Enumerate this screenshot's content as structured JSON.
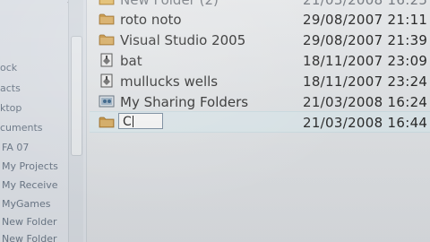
{
  "navigation": {
    "items": [
      "ock",
      "acts",
      "ktop",
      "cuments",
      "FA 07",
      "My Projects",
      "My Receive",
      "MyGames",
      "New Folder",
      "New Folder"
    ]
  },
  "files": {
    "rows": [
      {
        "name": "New Folder (2)",
        "date": "21/03/2008 16:25",
        "icon": "folder-icon"
      },
      {
        "name": "roto noto",
        "date": "29/08/2007 21:11",
        "icon": "folder-icon"
      },
      {
        "name": "Visual Studio 2005",
        "date": "29/08/2007 21:39",
        "icon": "folder-icon"
      },
      {
        "name": "bat",
        "date": "18/11/2007 23:09",
        "icon": "batch-file-icon"
      },
      {
        "name": "mullucks wells",
        "date": "18/11/2007 23:24",
        "icon": "batch-file-icon"
      },
      {
        "name": "My Sharing Folders",
        "date": "21/03/2008 16:24",
        "icon": "shared-folder-icon"
      }
    ],
    "rename_row": {
      "value": "C",
      "date": "21/03/2008 16:44",
      "icon": "folder-icon"
    }
  }
}
